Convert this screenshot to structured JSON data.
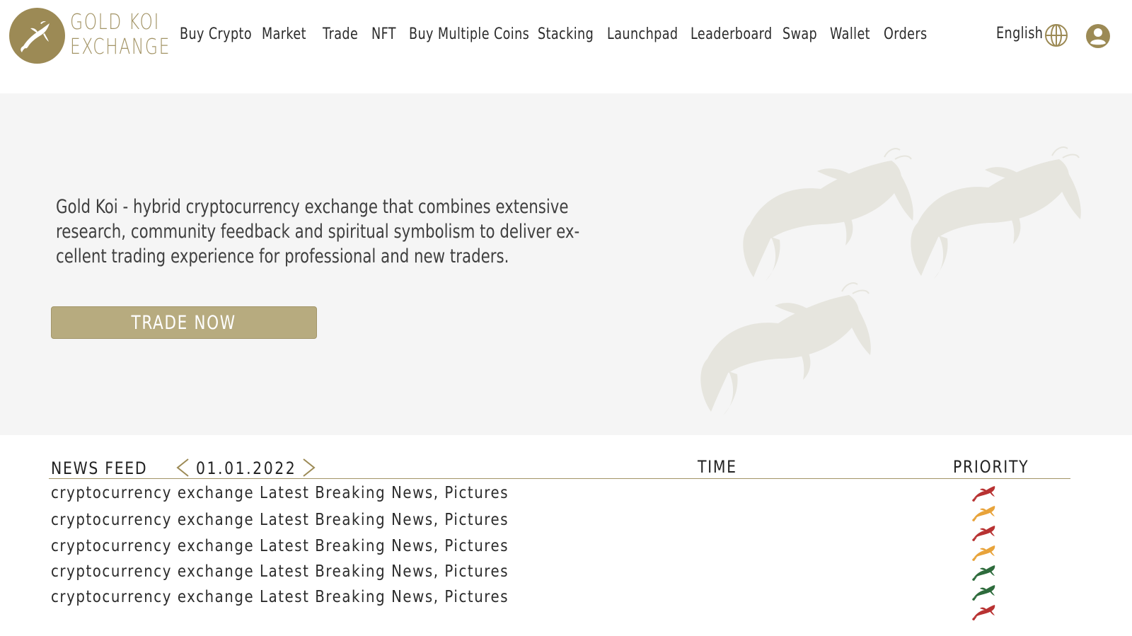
{
  "brand": {
    "line1": "GOLD KOI",
    "line2": "EXCHANGE",
    "color": "#9c8a55"
  },
  "nav": {
    "items": [
      "Buy Crypto",
      "Market",
      "Trade",
      "NFT",
      "Buy Multiple Coins",
      "Stacking",
      "Launchpad",
      "Leaderboard",
      "Swap",
      "Wallet",
      "Orders"
    ],
    "language": "English",
    "icons": [
      "globe-icon",
      "user-icon"
    ]
  },
  "hero": {
    "text": "Gold Koi - hybrid cryptocurrency exchange that combines extensive research, community feedback and spiritual symbolism to deliver ex­cellent trading experience for professional and new traders.",
    "line1": "Gold Koi - hybrid cryptocurrency exchange that combines extensive",
    "line2": "research, community feedback and spiritual symbolism to deliver ex-",
    "line3": "cellent trading experience for professional and new traders.",
    "cta_label": "TRADE NOW",
    "accent": "#b7ab7f"
  },
  "news": {
    "title": "NEWS FEED",
    "date": "01.01.2022",
    "col_time": "TIME",
    "col_priority": "PRIORITY",
    "rows": [
      "cryptocurrency exchange Latest Breaking News, Pictures",
      "cryptocurrency exchange Latest Breaking News, Pictures",
      "cryptocurrency exchange Latest Breaking News, Pictures",
      "cryptocurrency exchange Latest Breaking News, Pictures",
      "cryptocurrency exchange Latest Breaking News, Pictures"
    ],
    "priority_colors": [
      "#b83232",
      "#e8a33a",
      "#b83232",
      "#e8a33a",
      "#2e6b3c",
      "#2e6b3c",
      "#b83232"
    ]
  }
}
